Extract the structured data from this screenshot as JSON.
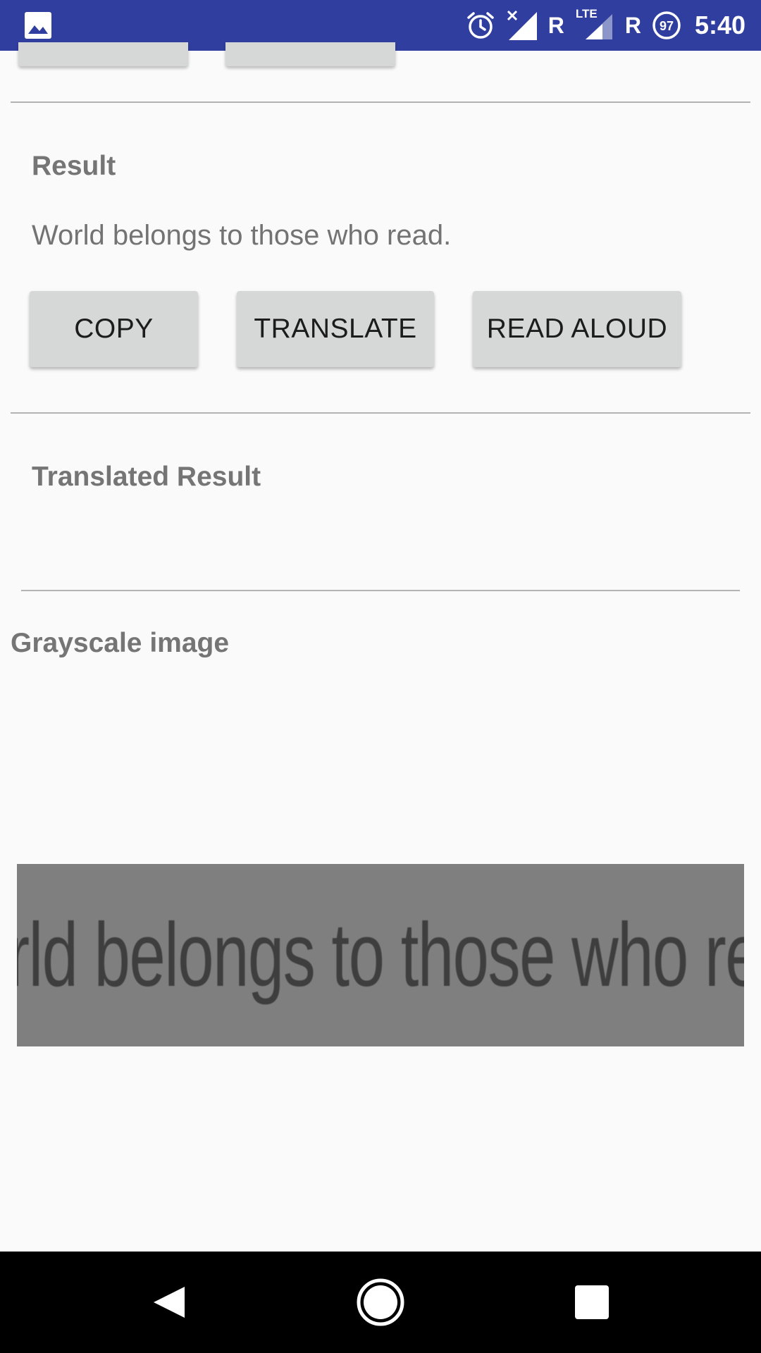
{
  "status_bar": {
    "left_icon": "image-icon",
    "icons": [
      "alarm-icon",
      "no-signal-icon",
      "lte-signal-icon",
      "battery-saver-icon"
    ],
    "roaming_label_1": "R",
    "lte_label": "LTE",
    "roaming_label_2": "R",
    "battery_level": "97",
    "time": "5:40",
    "background_color": "#303f9f"
  },
  "result": {
    "heading": "Result",
    "text": "World belongs to those who read."
  },
  "actions": {
    "copy_label": "COPY",
    "translate_label": "TRANSLATE",
    "read_aloud_label": "READ ALOUD"
  },
  "translated": {
    "heading": "Translated Result",
    "text": ""
  },
  "grayscale": {
    "heading": "Grayscale image",
    "image_text": "World belongs to those who read."
  },
  "nav_bar": {
    "icons": [
      "back-icon",
      "home-icon",
      "recents-icon"
    ]
  }
}
